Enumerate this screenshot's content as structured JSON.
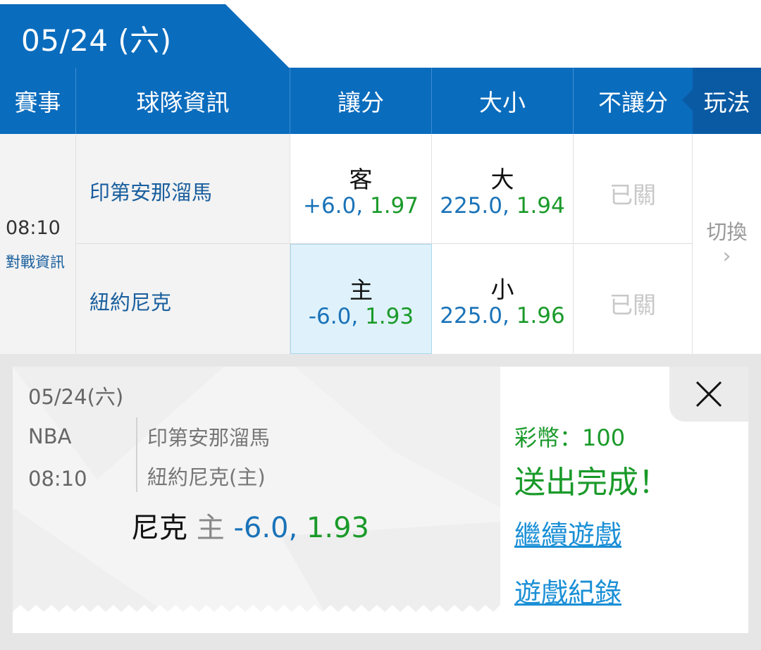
{
  "date_tab": {
    "label": "05/24 (六)"
  },
  "header": {
    "event": "賽事",
    "team_info": "球隊資訊",
    "handicap": "讓分",
    "over_under": "大小",
    "moneyline": "不讓分",
    "play": "玩法"
  },
  "match": {
    "time": "08:10",
    "info_link": "對戰資訊",
    "away_team": "印第安那溜馬",
    "home_team": "紐約尼克",
    "handicap": {
      "away": {
        "side": "客",
        "line": "+6.0,",
        "odds": "1.97"
      },
      "home": {
        "side": "主",
        "line": "-6.0,",
        "odds": "1.93"
      }
    },
    "over_under": {
      "over": {
        "side": "大",
        "line": "225.0,",
        "odds": "1.94"
      },
      "under": {
        "side": "小",
        "line": "225.0,",
        "odds": "1.96"
      }
    },
    "moneyline": {
      "away": "已關",
      "home": "已關"
    },
    "switch_label": "切換",
    "switch_chevron": "›"
  },
  "ticket": {
    "date": "05/24(六)",
    "league": "NBA",
    "time": "08:10",
    "away_team": "印第安那溜馬",
    "home_team": "紐約尼克(主)",
    "bet_team": "尼克",
    "bet_side": "主",
    "bet_line": "-6.0,",
    "bet_odds": "1.93",
    "coins": "彩幣：100",
    "status": "送出完成！",
    "continue_link": "繼續遊戲",
    "record_link": "遊戲紀錄",
    "close_icon": "close-icon"
  },
  "colors": {
    "brand_blue": "#0a6cbd",
    "dark_blue": "#0a5aa3",
    "odds_blue": "#1a73b8",
    "odds_green": "#1a9a2a",
    "link_blue": "#1a8fd6"
  }
}
